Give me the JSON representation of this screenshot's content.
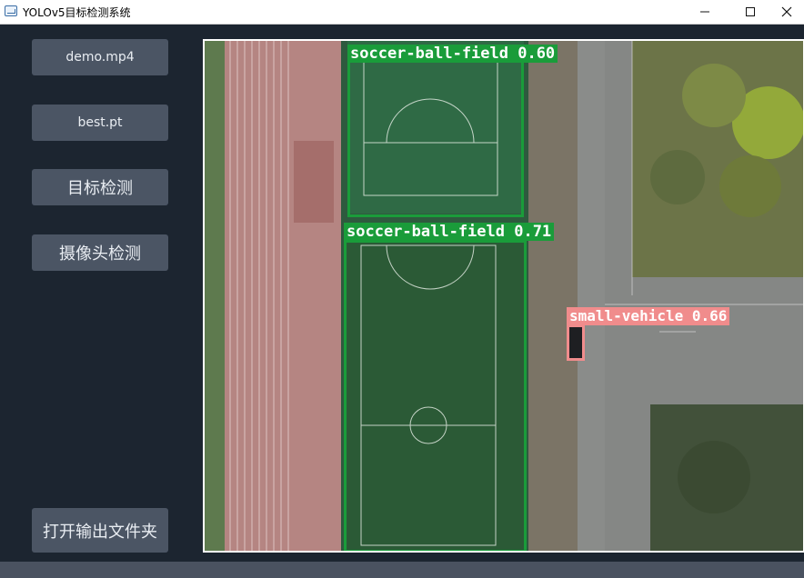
{
  "window": {
    "title": "YOLOv5目标检测系统",
    "controls": [
      "minimize-icon",
      "maximize-icon",
      "close-icon"
    ]
  },
  "sidebar": {
    "video_button": "demo.mp4",
    "weights_button": "best.pt",
    "detect_button": "目标检测",
    "camera_button": "摄像头检测",
    "open_output_button": "打开输出文件夹"
  },
  "viewer": {
    "detections": [
      {
        "label": "soccer-ball-field 0.60",
        "color": "#1a9c3a"
      },
      {
        "label": "soccer-ball-field 0.71",
        "color": "#1a9c3a"
      },
      {
        "label": "small-vehicle 0.66",
        "color": "#f08c8c"
      }
    ]
  }
}
